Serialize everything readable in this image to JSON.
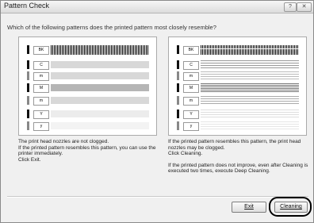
{
  "window": {
    "title": "Pattern Check",
    "help_label": "?",
    "close_label": "✕"
  },
  "question": "Which of the following patterns does the printed pattern most closely resemble?",
  "panels": {
    "left": {
      "rows": [
        "BK",
        "C",
        "m",
        "M",
        "m",
        "Y",
        "y"
      ]
    },
    "right": {
      "rows": [
        "BK",
        "C",
        "m",
        "M",
        "m",
        "Y",
        "y"
      ]
    }
  },
  "messages": {
    "left": [
      "The print head nozzles are not clogged.",
      "If the printed pattern resembles this pattern, you can use the printer immediately.",
      "Click Exit."
    ],
    "right": [
      "If the printed pattern resembles this pattern, the print head nozzles may be clogged.",
      "Click Cleaning.",
      "If the printed pattern does not improve, even after Cleaning is executed two times, execute Deep Cleaning."
    ]
  },
  "buttons": {
    "exit": "Exit",
    "cleaning": "Cleaning"
  },
  "colors": {
    "highlight": "#000000",
    "panel_bg": "#ffffff",
    "dialog_bg": "#f0f0f0"
  }
}
